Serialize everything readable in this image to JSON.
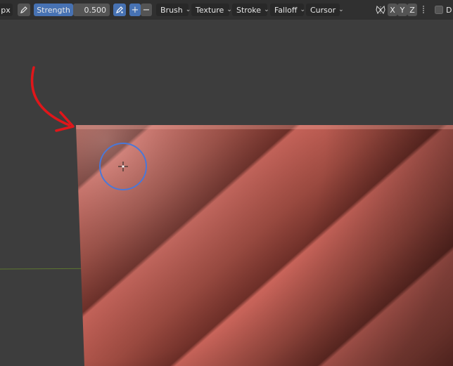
{
  "toolbar": {
    "unit_label": "px",
    "strength_label": "Strength",
    "strength_value": "0.500",
    "plus_label": "+",
    "minus_label": "−",
    "menus": [
      "Brush",
      "Texture",
      "Stroke",
      "Falloff",
      "Cursor"
    ],
    "axis_x": "X",
    "axis_y": "Y",
    "axis_z": "Z",
    "partial_label": "D"
  },
  "icons": {
    "pressure": "pen-pressure-icon",
    "brush_pressure": "brush-pressure-icon",
    "mirror": "butterfly-mirror-icon",
    "chevron": "chevron-down-icon",
    "checkbox": "checkbox-icon"
  },
  "colors": {
    "header_bg": "#303030",
    "viewport_bg": "#3d3d3d",
    "active_blue": "#4772b3",
    "mesh_red": "#b0554a",
    "brush_ring": "#4a78d8",
    "arrow_red": "#e0161a",
    "axis_green": "#6b8f2a"
  }
}
